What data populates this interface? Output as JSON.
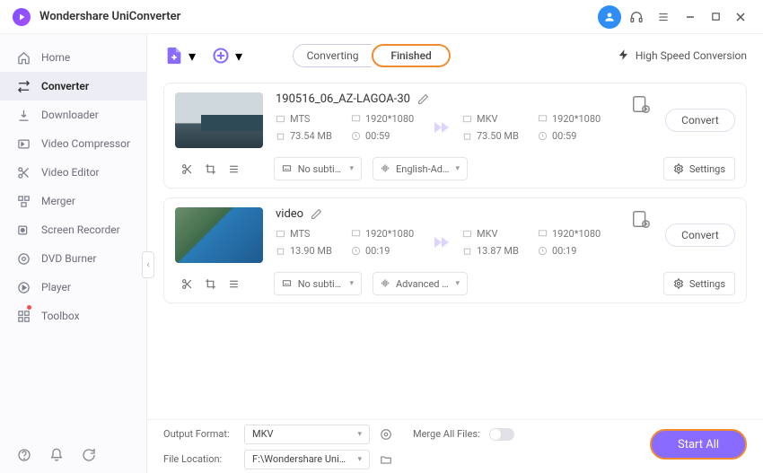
{
  "titlebar": {
    "title": "Wondershare UniConverter"
  },
  "sidebar": {
    "items": [
      {
        "label": "Home"
      },
      {
        "label": "Converter"
      },
      {
        "label": "Downloader"
      },
      {
        "label": "Video Compressor"
      },
      {
        "label": "Video Editor"
      },
      {
        "label": "Merger"
      },
      {
        "label": "Screen Recorder"
      },
      {
        "label": "DVD Burner"
      },
      {
        "label": "Player"
      },
      {
        "label": "Toolbox"
      }
    ]
  },
  "tabs": {
    "converting": "Converting",
    "finished": "Finished"
  },
  "hsconv": "High Speed Conversion",
  "files": [
    {
      "name": "190516_06_AZ-LAGOA-30",
      "in": {
        "fmt": "MTS",
        "res": "1920*1080",
        "size": "73.54 MB",
        "dur": "00:59"
      },
      "out": {
        "fmt": "MKV",
        "res": "1920*1080",
        "size": "73.50 MB",
        "dur": "00:59"
      },
      "subtitle": "No subtitle",
      "audio": "English-Advan...",
      "convert": "Convert",
      "settings": "Settings"
    },
    {
      "name": "video",
      "in": {
        "fmt": "MTS",
        "res": "1920*1080",
        "size": "13.90 MB",
        "dur": "00:19"
      },
      "out": {
        "fmt": "MKV",
        "res": "1920*1080",
        "size": "13.87 MB",
        "dur": "00:19"
      },
      "subtitle": "No subtitle",
      "audio": "Advanced Aud...",
      "convert": "Convert",
      "settings": "Settings"
    }
  ],
  "footer": {
    "outputFormatLabel": "Output Format:",
    "outputFormatValue": "MKV",
    "mergeLabel": "Merge All Files:",
    "fileLocationLabel": "File Location:",
    "fileLocationValue": "F:\\Wondershare UniConverter",
    "startAll": "Start All"
  }
}
